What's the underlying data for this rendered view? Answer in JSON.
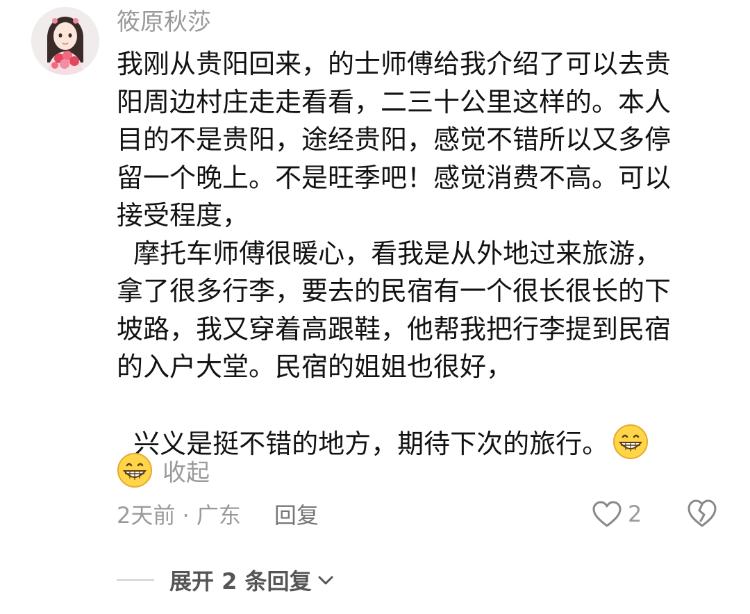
{
  "comment": {
    "username": "筱原秋莎",
    "avatar_icon": "avatar-girl-with-roses",
    "body_lines": [
      "我刚从贵阳回来，的士师傅给我介绍了可以去贵",
      "阳周边村庄走走看看，二三十公里这样的。本人",
      "目的不是贵阳，途经贵阳，感觉不错所以又多停",
      "留一个晚上。不是旺季吧！感觉消费不高。可以",
      "接受程度，",
      "  摩托车师傅很暖心，看我是从外地过来旅游，",
      "拿了很多行李，要去的民宿有一个很长很长的下",
      "坡路，我又穿着高跟鞋，他帮我把行李提到民宿",
      "的入户大堂。民宿的姐姐也很好，",
      "",
      "  兴义是挺不错的地方，期待下次的旅行。"
    ],
    "emoji_icon": "grinning-face-icon",
    "collapse_label": "收起",
    "meta": {
      "time_location": "2天前 · 广东",
      "reply_label": "回复"
    },
    "like_count": "2",
    "expand_replies_label": "展开 2 条回复"
  },
  "colors": {
    "secondary_text": "#9a9a9a",
    "body_text": "#121212",
    "emoji_fill": "#ffd54a"
  }
}
